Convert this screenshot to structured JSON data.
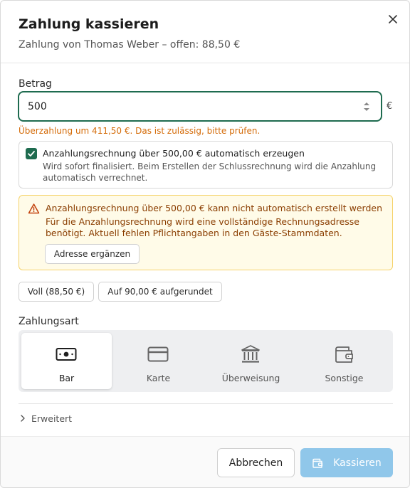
{
  "dialog": {
    "title": "Zahlung kassieren",
    "subtitle": "Zahlung von Thomas Weber – offen: 88,50 €"
  },
  "amount": {
    "label": "Betrag",
    "value": "500",
    "currency": "€",
    "warning": "Überzahlung um 411,50 €. Das ist zulässig, bitte prüfen."
  },
  "deposit_option": {
    "checked": true,
    "title": "Anzahlungsrechnung über 500,00 € automatisch erzeugen",
    "description": "Wird sofort finalisiert. Beim Erstellen der Schlussrechnung wird die Anzahlung automatisch verrechnet."
  },
  "alert": {
    "title": "Anzahlungsrechnung über 500,00 € kann nicht automatisch erstellt werden",
    "description": "Für die Anzahlungsrechnung wird eine vollständige Rechnungsadresse benötigt. Aktuell fehlen Pflichtangaben in den Gäste-Stammdaten.",
    "action_label": "Adresse ergänzen"
  },
  "quick_amounts": {
    "full_label": "Voll (88,50 €)",
    "rounded_label": "Auf 90,00 € aufgerundet"
  },
  "payment_method": {
    "label": "Zahlungsart",
    "selected": "Bar",
    "options": [
      {
        "label": "Bar",
        "icon": "cash-icon"
      },
      {
        "label": "Karte",
        "icon": "credit-card-icon"
      },
      {
        "label": "Überweisung",
        "icon": "bank-icon"
      },
      {
        "label": "Sonstige",
        "icon": "wallet-icon"
      }
    ]
  },
  "advanced": {
    "label": "Erweitert"
  },
  "footer": {
    "cancel_label": "Abbrechen",
    "submit_label": "Kassieren"
  },
  "colors": {
    "accent": "#1e6b4f",
    "primary_disabled": "#90c7ea",
    "warning_text": "#d46b08",
    "alert_bg": "#fffbe8",
    "alert_border": "#f5d36b"
  }
}
